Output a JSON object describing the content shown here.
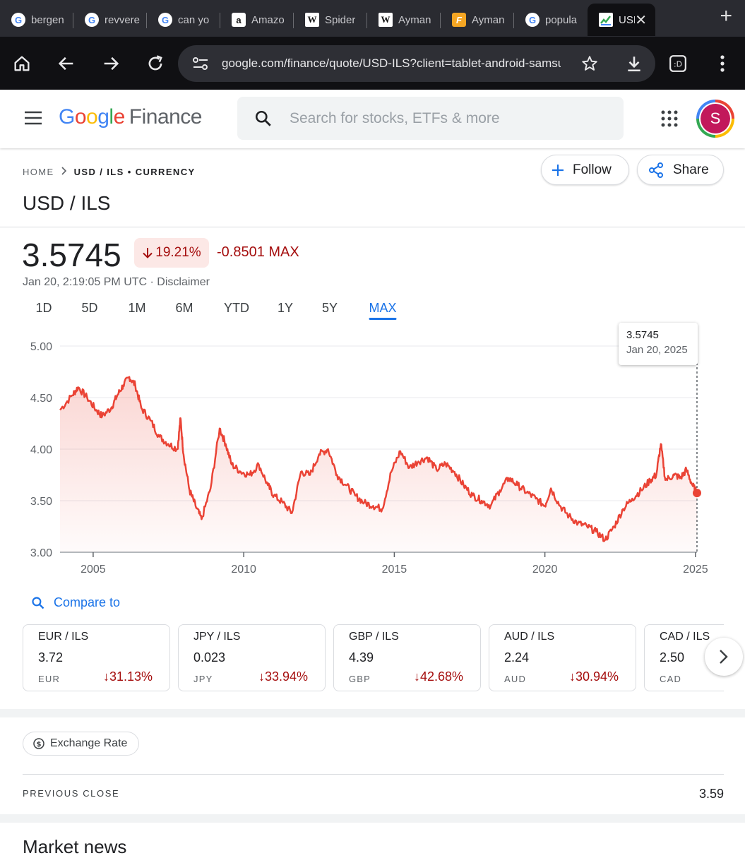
{
  "browser": {
    "tabs": [
      {
        "label": "bergen",
        "favicon": "google"
      },
      {
        "label": "revvere",
        "favicon": "google"
      },
      {
        "label": "can yo",
        "favicon": "google"
      },
      {
        "label": "Amazo",
        "favicon": "amazon"
      },
      {
        "label": "Spider",
        "favicon": "wikipedia"
      },
      {
        "label": "Ayman",
        "favicon": "wikipedia"
      },
      {
        "label": "Ayman",
        "favicon": "flipboard"
      },
      {
        "label": "popula",
        "favicon": "google"
      },
      {
        "label": "USD",
        "favicon": "finance",
        "active": true
      }
    ],
    "url": "google.com/finance/quote/USD-ILS?client=tablet-android-samsung"
  },
  "header": {
    "logo_google": "Google",
    "logo_finance": "Finance",
    "search_placeholder": "Search for stocks, ETFs & more",
    "avatar_letter": "S"
  },
  "breadcrumb": {
    "home": "HOME",
    "current": "USD / ILS • CURRENCY"
  },
  "actions": {
    "follow": "Follow",
    "share": "Share"
  },
  "title": "USD / ILS",
  "quote": {
    "price": "3.5745",
    "pct_change": "19.21%",
    "abs_change": "-0.8501 MAX",
    "timestamp": "Jan 20, 2:19:05 PM UTC · Disclaimer"
  },
  "ranges": [
    "1D",
    "5D",
    "1M",
    "6M",
    "YTD",
    "1Y",
    "5Y",
    "MAX"
  ],
  "active_range": "MAX",
  "tooltip": {
    "value": "3.5745",
    "date": "Jan 20, 2025"
  },
  "colors": {
    "down": "#a50e0e",
    "line": "#ea4335",
    "accent": "#1a73e8"
  },
  "chart_data": {
    "type": "area",
    "ylim": [
      3.0,
      5.0
    ],
    "yticks": [
      "5.00",
      "4.50",
      "4.00",
      "3.50",
      "3.00"
    ],
    "xticks": [
      "2005",
      "2010",
      "2015",
      "2020",
      "2025"
    ],
    "xlim": [
      2003.9,
      2025.05
    ],
    "series": [
      {
        "points": [
          [
            2003.9,
            4.38
          ],
          [
            2004.3,
            4.52
          ],
          [
            2004.5,
            4.6
          ],
          [
            2004.8,
            4.5
          ],
          [
            2005.1,
            4.38
          ],
          [
            2005.3,
            4.32
          ],
          [
            2005.6,
            4.4
          ],
          [
            2005.8,
            4.52
          ],
          [
            2006.0,
            4.62
          ],
          [
            2006.2,
            4.7
          ],
          [
            2006.4,
            4.62
          ],
          [
            2006.6,
            4.4
          ],
          [
            2006.9,
            4.28
          ],
          [
            2007.2,
            4.12
          ],
          [
            2007.5,
            4.05
          ],
          [
            2007.8,
            4.0
          ],
          [
            2007.9,
            4.3
          ],
          [
            2008.0,
            3.95
          ],
          [
            2008.2,
            3.6
          ],
          [
            2008.4,
            3.45
          ],
          [
            2008.6,
            3.32
          ],
          [
            2008.9,
            3.62
          ],
          [
            2009.2,
            4.2
          ],
          [
            2009.4,
            4.05
          ],
          [
            2009.6,
            3.85
          ],
          [
            2009.9,
            3.78
          ],
          [
            2010.2,
            3.75
          ],
          [
            2010.5,
            3.85
          ],
          [
            2010.8,
            3.65
          ],
          [
            2011.0,
            3.55
          ],
          [
            2011.3,
            3.48
          ],
          [
            2011.6,
            3.38
          ],
          [
            2011.9,
            3.78
          ],
          [
            2012.2,
            3.75
          ],
          [
            2012.5,
            3.95
          ],
          [
            2012.8,
            4.0
          ],
          [
            2013.1,
            3.75
          ],
          [
            2013.4,
            3.65
          ],
          [
            2013.7,
            3.55
          ],
          [
            2014.0,
            3.48
          ],
          [
            2014.3,
            3.45
          ],
          [
            2014.6,
            3.42
          ],
          [
            2014.9,
            3.78
          ],
          [
            2015.2,
            3.98
          ],
          [
            2015.5,
            3.82
          ],
          [
            2015.8,
            3.88
          ],
          [
            2016.1,
            3.92
          ],
          [
            2016.4,
            3.8
          ],
          [
            2016.7,
            3.86
          ],
          [
            2017.0,
            3.78
          ],
          [
            2017.3,
            3.65
          ],
          [
            2017.6,
            3.55
          ],
          [
            2017.9,
            3.5
          ],
          [
            2018.2,
            3.45
          ],
          [
            2018.5,
            3.6
          ],
          [
            2018.8,
            3.72
          ],
          [
            2019.1,
            3.65
          ],
          [
            2019.4,
            3.58
          ],
          [
            2019.7,
            3.52
          ],
          [
            2020.0,
            3.45
          ],
          [
            2020.2,
            3.62
          ],
          [
            2020.5,
            3.45
          ],
          [
            2020.8,
            3.35
          ],
          [
            2021.1,
            3.28
          ],
          [
            2021.4,
            3.25
          ],
          [
            2021.7,
            3.2
          ],
          [
            2022.0,
            3.12
          ],
          [
            2022.3,
            3.25
          ],
          [
            2022.6,
            3.42
          ],
          [
            2022.9,
            3.52
          ],
          [
            2023.2,
            3.6
          ],
          [
            2023.5,
            3.7
          ],
          [
            2023.7,
            3.75
          ],
          [
            2023.85,
            4.05
          ],
          [
            2024.0,
            3.7
          ],
          [
            2024.3,
            3.75
          ],
          [
            2024.5,
            3.72
          ],
          [
            2024.7,
            3.8
          ],
          [
            2024.9,
            3.65
          ],
          [
            2025.05,
            3.5745
          ]
        ]
      }
    ]
  },
  "compare_label": "Compare to",
  "related": [
    {
      "pair": "EUR / ILS",
      "value": "3.72",
      "code": "EUR",
      "pct": "31.13%"
    },
    {
      "pair": "JPY / ILS",
      "value": "0.023",
      "code": "JPY",
      "pct": "33.94%"
    },
    {
      "pair": "GBP / ILS",
      "value": "4.39",
      "code": "GBP",
      "pct": "42.68%"
    },
    {
      "pair": "AUD / ILS",
      "value": "2.24",
      "code": "AUD",
      "pct": "30.94%"
    },
    {
      "pair": "CAD / ILS",
      "value": "2.50",
      "code": "CAD",
      "pct": ""
    }
  ],
  "stats": {
    "chip_label": "Exchange Rate",
    "previous_close_label": "PREVIOUS CLOSE",
    "previous_close_value": "3.59"
  },
  "news_heading": "Market news"
}
